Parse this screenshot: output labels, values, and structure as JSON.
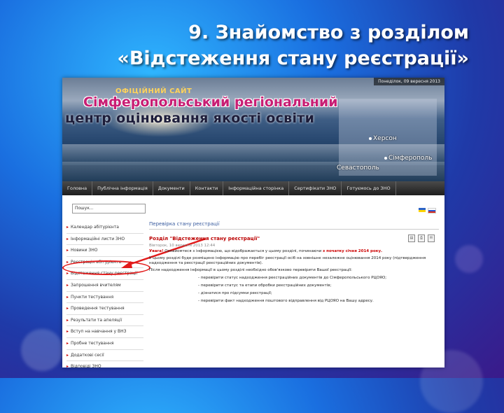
{
  "slide": {
    "title_line1": "9. Знайомство з розділом",
    "title_line2": "«Відстеження стану реєстрації»"
  },
  "banner": {
    "topline": "Понеділок, 09 вересня 2013",
    "official": "ОФІЦІЙНИЙ САЙТ",
    "brand_line1": "Сімферопольський регіональний",
    "brand_line2": "центр оцінювання якості освіти",
    "cities": [
      "Херсон",
      "Сімферополь",
      "Севастополь"
    ]
  },
  "nav": {
    "items": [
      "Головна",
      "Публічна інформація",
      "Документи",
      "Контакти",
      "Інформаційна сторінка",
      "Сертифікати ЗНО",
      "Готуємось до ЗНО"
    ]
  },
  "search": {
    "value": "Пошук..."
  },
  "menu": {
    "items": [
      "Календар абітурієнта",
      "Інформаційні листи ЗНО",
      "Новини ЗНО",
      "Реєстрація абітурієнта",
      "Відстеження стану реєстрації",
      "Запрошення вчителям",
      "Пункти тестування",
      "Проведення тестування",
      "Результати та апеляції",
      "Вступ на навчання у ВНЗ",
      "Пробне тестування",
      "Додаткові сесії",
      "Відповіді ЗНО"
    ]
  },
  "content": {
    "page_title": "Перевірка стану реєстрації",
    "section_title": "Розділ \"Відстеження стану реєстрації\"",
    "date": "Вівторок, 10 вересня 2013 12:44",
    "p1_lead": "Увага!",
    "p1": "Ознайомтеся з інформацією, що відображається у цьому розділі, починаючи",
    "p1_red": "з початку січня 2014 року.",
    "p2": "У цьому розділі буде розміщено інформацію про перебіг реєстрації осіб на зовнішнє незалежне оцінювання 2014 року (підтвердження надходження та реєстрації реєстраційних документів).",
    "p3": "Після надходження інформації в цьому розділі необхідно обов'язково перевірити Вашої реєстрації:",
    "list": [
      "- перевірити статус надходження реєстраційних документів до Сімферопольського РЦОЯО;",
      "- перевірити статус та етапи обробки реєстраційних документів;",
      "- дізнатися про підсумки реєстрації;",
      "- перевірити факт надходження поштового відправлення від РЦОЯО на Вашу адресу."
    ]
  },
  "colors": {
    "accent_red": "#e21b1b",
    "brand_magenta": "#c81e74"
  }
}
